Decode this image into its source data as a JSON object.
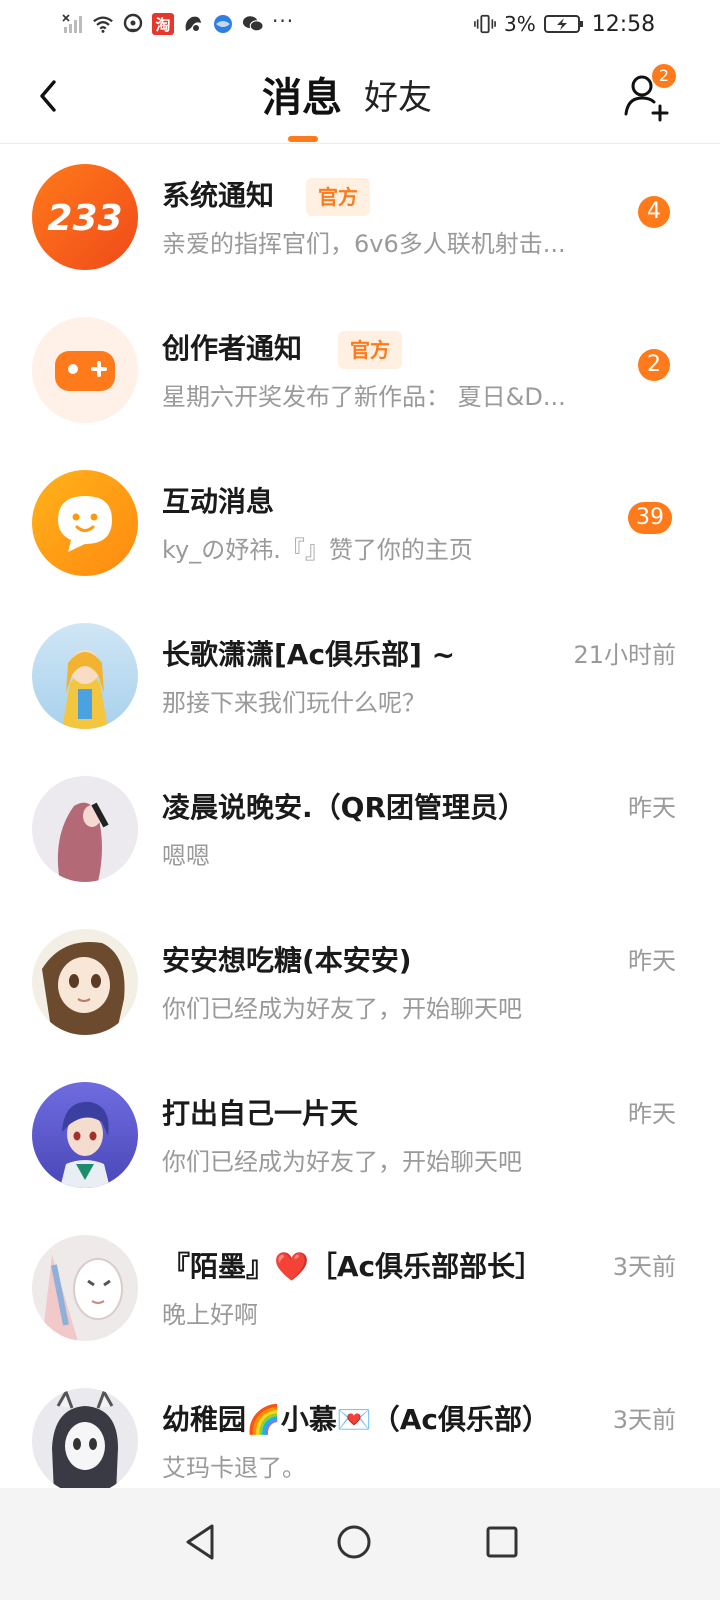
{
  "status_bar": {
    "battery_percent": "3%",
    "time": "12:58",
    "overflow": "···",
    "left_icons": [
      "no-signal-icon",
      "wifi-icon",
      "hotspot-icon",
      "taobao-icon",
      "app-icon",
      "browser-icon",
      "wechat-icon"
    ],
    "right_icons": [
      "vibrate-icon",
      "battery-charging-icon"
    ]
  },
  "header": {
    "tabs": [
      {
        "label": "消息",
        "active": true
      },
      {
        "label": "好友",
        "active": false
      }
    ],
    "friend_request_badge": "2",
    "accent_color": "#ff7a1a"
  },
  "messages": [
    {
      "name": "系统通知",
      "official_label": "官方",
      "preview": "亲爱的指挥官们，6v6多人联机射击...",
      "unread": "4",
      "avatar": "233-logo"
    },
    {
      "name": "创作者通知",
      "official_label": "官方",
      "preview": "星期六开奖发布了新作品：  夏日&D...",
      "unread": "2",
      "avatar": "gamepad-icon"
    },
    {
      "name": "互动消息",
      "preview": "ky_の妤祎.『』赞了你的主页",
      "unread": "39",
      "avatar": "chat-bubble-icon"
    },
    {
      "name": "长歌潇潇[Ac俱乐部] ~",
      "preview": "那接下来我们玩什么呢？",
      "time": "21小时前",
      "avatar": "anime-girl-yellow"
    },
    {
      "name": "凌晨说晚安.（QR团管理员）",
      "preview": "嗯嗯",
      "time": "昨天",
      "avatar": "anime-girl-pink-hair"
    },
    {
      "name": "安安想吃糖(本安安)",
      "preview": "你们已经成为好友了，开始聊天吧",
      "time": "昨天",
      "avatar": "anime-girl-brown-hair"
    },
    {
      "name": "打出自己一片天",
      "preview": "你们已经成为好友了，开始聊天吧",
      "time": "昨天",
      "avatar": "anime-boy-purple-hair"
    },
    {
      "name": "『陌墨』❤️［Ac俱乐部部长］",
      "preview": "晚上好啊",
      "time": "3天前",
      "avatar": "anime-mask"
    },
    {
      "name": "幼稚园🌈小慕💌（Ac俱乐部）",
      "preview": "艾玛卡退了。",
      "time": "3天前",
      "avatar": "anime-girl-sketch"
    }
  ],
  "nav_bar": {
    "buttons": [
      "back-triangle-icon",
      "home-circle-icon",
      "recents-square-icon"
    ]
  }
}
